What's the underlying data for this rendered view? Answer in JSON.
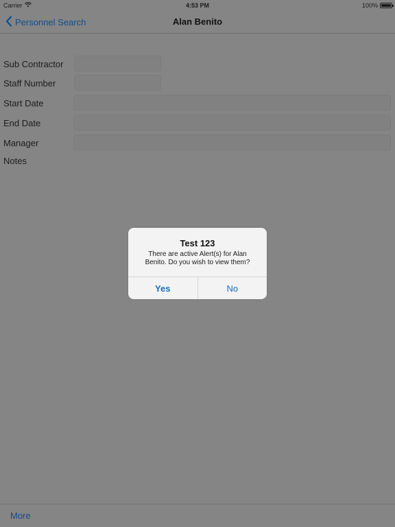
{
  "status_bar": {
    "carrier": "Carrier",
    "time": "4:53 PM",
    "battery": "100%",
    "battery_level": 1.0,
    "wifi_icon": "wifi-icon"
  },
  "nav": {
    "back_label": "Personnel Search",
    "back_icon": "chevron-left-icon",
    "title": "Alan Benito"
  },
  "form": {
    "fields": [
      {
        "label": "Sub Contractor",
        "value": ""
      },
      {
        "label": "Staff Number",
        "value": ""
      },
      {
        "label": "Start Date",
        "value": ""
      },
      {
        "label": "End Date",
        "value": ""
      },
      {
        "label": "Manager",
        "value": ""
      }
    ],
    "notes_label": "Notes"
  },
  "alert": {
    "title": "Test 123",
    "message": "There are active Alert(s) for Alan Benito. Do you wish to view them?",
    "yes_label": "Yes",
    "no_label": "No",
    "button_color": "#1a6fc0"
  },
  "toolbar": {
    "more_label": "More"
  },
  "colors": {
    "accent": "#0d4f8c",
    "dimmed_background": "#858585",
    "alert_background": "#f3f3f3"
  }
}
